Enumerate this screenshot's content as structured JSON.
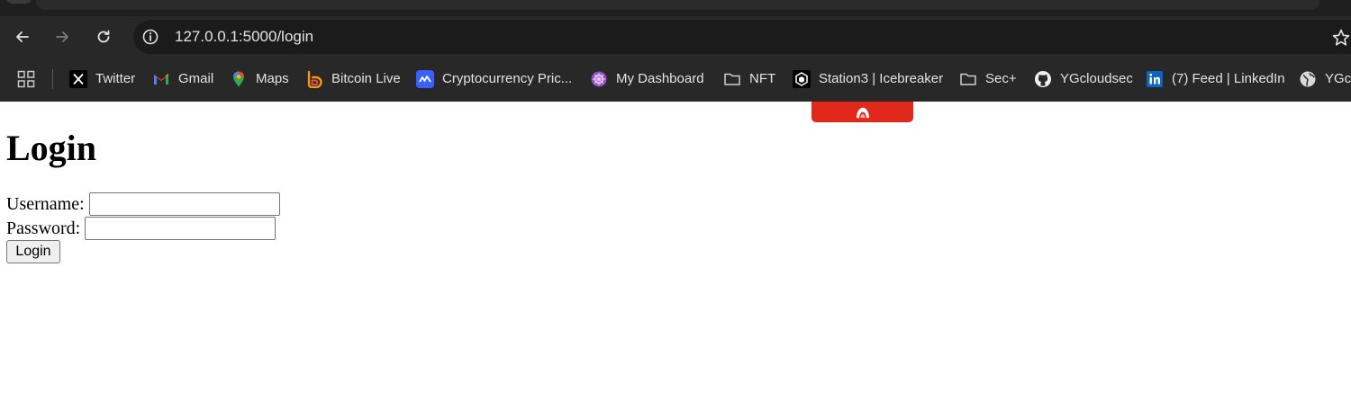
{
  "browser": {
    "url": "127.0.0.1:5000/login",
    "icons": {
      "back": "arrow-left-icon",
      "forward": "arrow-right-icon",
      "reload": "reload-icon",
      "site_info": "info-icon",
      "bookmark_star": "star-icon",
      "apps": "apps-grid-icon"
    },
    "bookmarks": [
      {
        "label": "Twitter",
        "icon": "x-logo-icon"
      },
      {
        "label": "Gmail",
        "icon": "gmail-icon"
      },
      {
        "label": "Maps",
        "icon": "maps-pin-icon"
      },
      {
        "label": "Bitcoin Live",
        "icon": "bitcoin-live-icon"
      },
      {
        "label": "Cryptocurrency Pric...",
        "icon": "coinmarketcap-icon"
      },
      {
        "label": "My Dashboard",
        "icon": "dashboard-icon"
      },
      {
        "label": "NFT",
        "icon": "folder-icon"
      },
      {
        "label": "Station3 | Icebreaker",
        "icon": "station3-icon"
      },
      {
        "label": "Sec+",
        "icon": "folder-icon"
      },
      {
        "label": "YGcloudsec",
        "icon": "github-icon"
      },
      {
        "label": "(7) Feed | LinkedIn",
        "icon": "linkedin-icon"
      },
      {
        "label": "YGcl",
        "icon": "globe-icon"
      }
    ]
  },
  "vpn_tab": {
    "icon": "vpn-icon",
    "color": "#e0291b"
  },
  "page": {
    "title": "Login",
    "username_label": "Username:",
    "username_value": "",
    "password_label": "Password:",
    "password_value": "",
    "submit_label": "Login"
  },
  "colors": {
    "chrome_dark": "#282828",
    "omnibox": "#1b1b1b",
    "chrome_text": "#e3e3e3",
    "vpn_red": "#e0291b"
  }
}
